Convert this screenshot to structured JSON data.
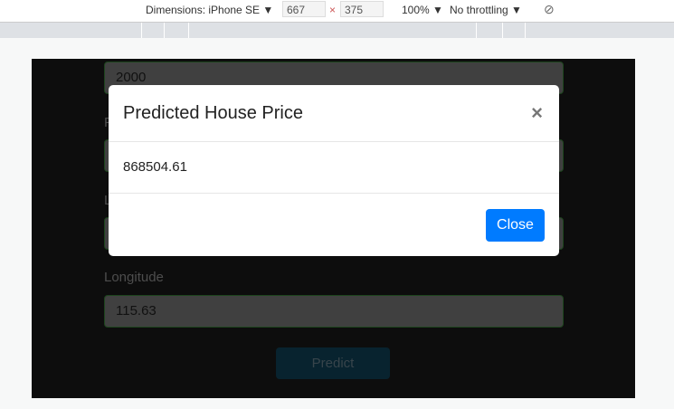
{
  "devtools": {
    "dimensions_label": "Dimensions: iPhone SE",
    "width": "667",
    "times": "×",
    "height": "375",
    "zoom": "100%",
    "throttling": "No throttling",
    "arrow": "▼"
  },
  "form": {
    "field1_value": "2000",
    "label2": "P",
    "label3": "L",
    "label4": "Longitude",
    "field4_value": "115.63",
    "predict_label": "Predict"
  },
  "modal": {
    "title": "Predicted House Price",
    "close_x": "×",
    "result": "868504.61",
    "close_label": "Close"
  }
}
